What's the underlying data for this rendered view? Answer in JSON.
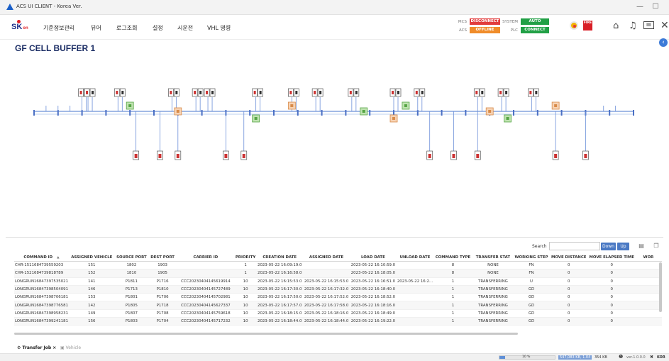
{
  "window": {
    "title": "ACS UI CLIENT - Korea Ver.",
    "minimize": "—",
    "maximize": "☐"
  },
  "header": {
    "logo": "SK",
    "logo_sub": "on",
    "menu": [
      "기준정보관리",
      "뷰어",
      "로그조회",
      "설정",
      "시운전",
      "VHL 명령"
    ],
    "status": {
      "mcs_label": "MCS",
      "mcs_value": "DISCONNECT",
      "mcs_color": "#e23c3c",
      "system_label": "SYSTEM",
      "system_value": "AUTO",
      "system_color": "#22a046",
      "acs_label": "ACS",
      "acs_value": "OFFLINE",
      "acs_color": "#f08c2a",
      "plc_label": "PLC",
      "plc_value": "CONNECT",
      "plc_color": "#22a046"
    },
    "fire_label": "FIRE"
  },
  "page": {
    "title": "GF CELL BUFFER 1"
  },
  "search": {
    "label": "Search",
    "value": "",
    "down_label": "Down",
    "up_label": "Up"
  },
  "table": {
    "columns": [
      "COMMAND ID",
      "ASSIGNED VEHICLE",
      "SOURCE PORT",
      "DEST PORT",
      "CARRIER ID",
      "PRIORITY",
      "CREATION DATE",
      "ASSIGNED DATE",
      "LOAD DATE",
      "UNLOAD DATE",
      "COMMAND TYPE",
      "TRANSFER STAT",
      "WORKING STEP",
      "MOVE DISTANCE",
      "MOVE ELAPSED TIME",
      "WOR"
    ],
    "sort_indicator": "▲",
    "rows": [
      [
        "CHR-1511684739559203",
        "151",
        "1802",
        "1903",
        "",
        "1",
        "2023-05-22 16:09:19.0",
        "",
        "2023-05-22 16:10:59.0",
        "",
        "8",
        "NONE",
        "FN",
        "0",
        "0",
        ""
      ],
      [
        "CHR-1521684739818789",
        "152",
        "1810",
        "1905",
        "",
        "1",
        "2023-05-22 16:16:58.0",
        "",
        "2023-05-22 16:18:05.0",
        "",
        "8",
        "NONE",
        "FN",
        "0",
        "0",
        ""
      ],
      [
        "LONGRUN16847397535021",
        "141",
        "P1811",
        "P1716",
        "CCC20230404145619914",
        "10",
        "2023-05-22 16:15:53.0",
        "2023-05-22 16:15:53.0",
        "2023-05-22 16:16:51.0",
        "2023-05-22 16:2...",
        "1",
        "TRANSFERRING",
        "U",
        "0",
        "0",
        ""
      ],
      [
        "LONGRUN16847398504091",
        "146",
        "P1713",
        "P1810",
        "CCC20230404145727489",
        "10",
        "2023-05-22 16:17:30.0",
        "2023-05-22 16:17:32.0",
        "2023-05-22 16:18:40.0",
        "",
        "1",
        "TRANSFERRING",
        "GD",
        "0",
        "0",
        ""
      ],
      [
        "LONGRUN16847398706181",
        "153",
        "P1801",
        "P1706",
        "CCC20230404145702981",
        "10",
        "2023-05-22 16:17:50.0",
        "2023-05-22 16:17:52.0",
        "2023-05-22 16:18:52.0",
        "",
        "1",
        "TRANSFERRING",
        "GD",
        "0",
        "0",
        ""
      ],
      [
        "LONGRUN16847398776581",
        "142",
        "P1805",
        "P1718",
        "CCC20230404145627337",
        "10",
        "2023-05-22 16:17:57.0",
        "2023-05-22 16:17:58.0",
        "2023-05-22 16:18:16.0",
        "",
        "1",
        "TRANSFERRING",
        "GD",
        "0",
        "0",
        ""
      ],
      [
        "LONGRUN16847398958231",
        "149",
        "P1807",
        "P1708",
        "CCC20230404145759618",
        "10",
        "2023-05-22 16:18:15.0",
        "2023-05-22 16:18:16.0",
        "2023-05-22 16:18:49.0",
        "",
        "1",
        "TRANSFERRING",
        "GD",
        "0",
        "0",
        ""
      ],
      [
        "LONGRUN16847399241181",
        "156",
        "P1803",
        "P1704",
        "CCC20230404145717232",
        "10",
        "2023-05-22 16:18:44.0",
        "2023-05-22 16:18:44.0",
        "2023-05-22 16:19:22.0",
        "",
        "1",
        "TRANSFERRING",
        "GD",
        "0",
        "0",
        ""
      ]
    ]
  },
  "tabs": [
    {
      "label": "Transfer Job",
      "close": "×"
    },
    {
      "label": "Vehicle"
    }
  ],
  "statusbar": {
    "progress": "10 %",
    "memory": "547,083 KB, 1.04",
    "memory2": "354 KB",
    "version": "ver.1.0.0.0",
    "lang": "KOR"
  },
  "diagram": {
    "upper_bays": [
      8,
      9,
      14,
      23,
      27,
      29,
      37,
      43,
      47,
      53,
      60,
      64,
      74,
      78,
      83
    ],
    "lower_bays": [
      17,
      21,
      24,
      32,
      35,
      66,
      70,
      74,
      87,
      92
    ],
    "vehicles": [
      16,
      24,
      37,
      43,
      55,
      60,
      62,
      76,
      79,
      87
    ]
  }
}
